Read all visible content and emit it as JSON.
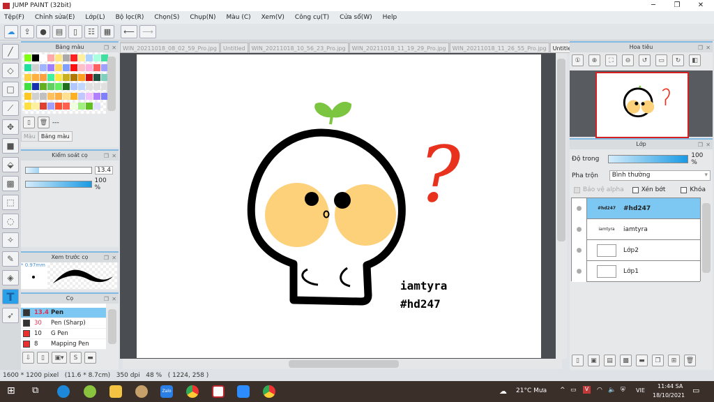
{
  "app": {
    "title": "JUMP PAINT (32bit)"
  },
  "menu": [
    "Tệp(F)",
    "Chỉnh sửa(E)",
    "Lớp(L)",
    "Bộ lọc(R)",
    "Chọn(S)",
    "Chụp(N)",
    "Màu (C)",
    "Xem(V)",
    "Công cụ(T)",
    "Cửa sổ(W)",
    "Help"
  ],
  "palette_panel": {
    "title": "Bảng màu",
    "tab_color": "Màu",
    "tab_palette": "Bảng màu",
    "palette_name": "---",
    "colors": [
      "#80ff10",
      "#000000",
      "#ffffff",
      "#ffaaaa",
      "#ffe680",
      "#aaaaaa",
      "#ff2020",
      "#fff0a0",
      "#aad4ff",
      "#aaffe0",
      "#40e0a0",
      "#20e0a0",
      "#d0d0d0",
      "#a0b4ff",
      "#a080ff",
      "#ffd860",
      "#80a0ff",
      "#ff1010",
      "#ffc0c8",
      "#ffb0e0",
      "#ff6060",
      "#a0a0ff",
      "#ffd040",
      "#ffb040",
      "#ffa040",
      "#40f0a0",
      "#ffe840",
      "#c8b020",
      "#b07800",
      "#ffa020",
      "#d01010",
      "#205040",
      "#80d0c0",
      "#40e040",
      "#1830b0",
      "#60b020",
      "#60d060",
      "#60f060",
      "#207020",
      "#b0c8ff",
      "#c0d8ff",
      "#e0e0e0",
      "#e0e0e0",
      "#e0e0e0",
      "#ffc820",
      "#d0d0d0",
      "#c0c0c0",
      "#ffc060",
      "#ffb040",
      "#ffe090",
      "#ffb020",
      "#c0c8ff",
      "#f0c0ff",
      "#b080ff",
      "#8080ff",
      "#ffe040",
      "#fff0a0",
      "#e04030",
      "#a0a0ff",
      "#ff5030",
      "#ff6050",
      "#f0ffe0",
      "#a0f080",
      "#60c020",
      "#e0e0ff"
    ]
  },
  "brush_control": {
    "title": "Kiểm soát cọ",
    "size": "13.4",
    "size_fraction": 0.2,
    "opacity": "100 %",
    "opacity_fraction": 1.0
  },
  "brush_preview": {
    "title": "Xem trước cọ",
    "size_mm": "* 0.97mm"
  },
  "brushes": {
    "title": "Cọ",
    "items": [
      {
        "size": "13.4",
        "name": "Pen",
        "color": "#333333",
        "selected": true
      },
      {
        "size": "30",
        "name": "Pen (Sharp)",
        "color": "#333333"
      },
      {
        "size": "10",
        "name": "G Pen",
        "color": "#e83030"
      },
      {
        "size": "8",
        "name": "Mapping Pen",
        "color": "#e83030"
      }
    ]
  },
  "tabs": [
    "WIN_20211018_08_02_59_Pro.jpg",
    "Untitled",
    "WIN_20211018_10_56_23_Pro.jpg",
    "WIN_20211018_11_19_29_Pro.jpg",
    "WIN_20211018_11_26_55_Pro.jpg",
    "Untitled"
  ],
  "active_tab": 5,
  "artwork": {
    "text1": "iamtyra",
    "text2": "#hd247",
    "question": "?"
  },
  "navigator": {
    "title": "Hoa tiêu"
  },
  "layers": {
    "title": "Lớp",
    "opacity_label": "Độ trong",
    "opacity_value": "100 %",
    "blend_label": "Pha trộn",
    "blend_value": "Bình thường",
    "protect_alpha": "Bảo vệ alpha",
    "clipping": "Xén bớt",
    "lock": "Khóa",
    "items": [
      {
        "name": "#hd247",
        "thumb": "#hd247",
        "selected": true
      },
      {
        "name": "iamtyra",
        "thumb": "iamtyra"
      },
      {
        "name": "Lớp2",
        "thumb": ""
      },
      {
        "name": "Lớp1",
        "thumb": ""
      }
    ]
  },
  "status": {
    "size": "1600 * 1200 pixel",
    "cm": "(11.6 * 8.7cm)",
    "dpi": "350 dpi",
    "zoom": "48 %",
    "coords": "( 1224, 258 )"
  },
  "taskbar": {
    "weather": "21°C  Mưa",
    "lang": "VIE",
    "time": "11:44 SA",
    "date": "18/10/2021"
  },
  "colors": {
    "accent": "#2aa0e8",
    "cheek": "#fdd07a",
    "sprout": "#7cc540",
    "question": "#e8321e"
  }
}
